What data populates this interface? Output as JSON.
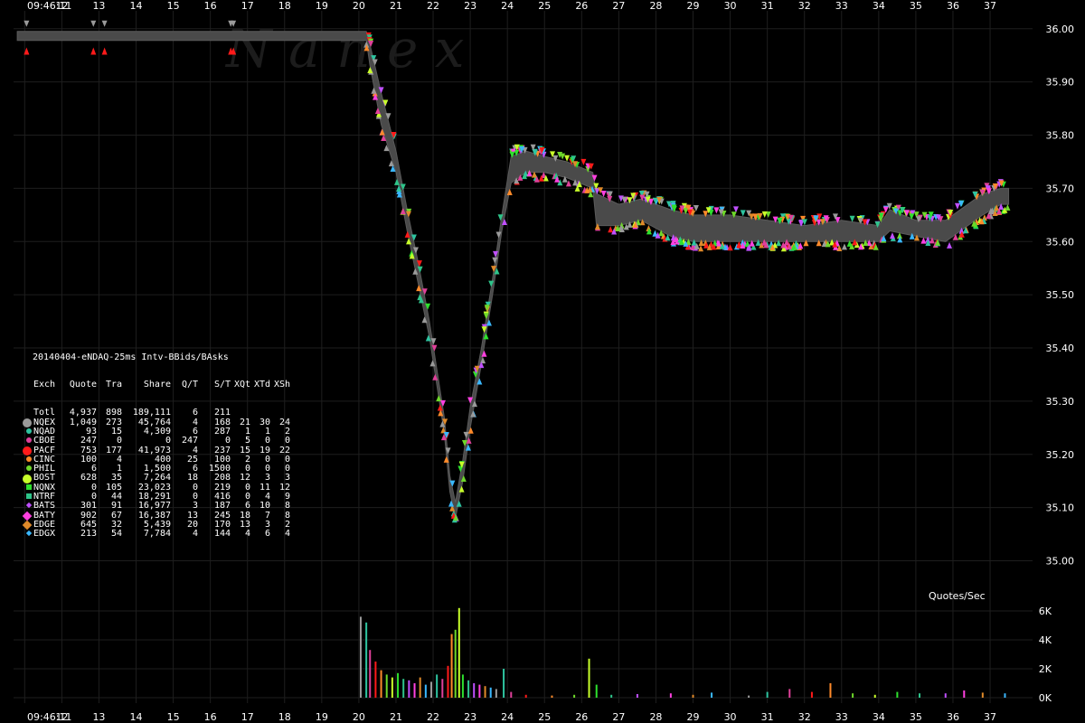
{
  "watermark": "N a n e x",
  "chart_data": [
    {
      "type": "scatter",
      "title": "",
      "xlabel": "",
      "ylabel": "",
      "x_ticks": [
        "09:46:11",
        "12",
        "13",
        "14",
        "15",
        "16",
        "17",
        "18",
        "19",
        "20",
        "21",
        "22",
        "23",
        "24",
        "25",
        "26",
        "27",
        "28",
        "29",
        "30",
        "31",
        "32",
        "33",
        "34",
        "35",
        "36",
        "37"
      ],
      "x_tick_values": [
        11,
        12,
        13,
        14,
        15,
        16,
        17,
        18,
        19,
        20,
        21,
        22,
        23,
        24,
        25,
        26,
        27,
        28,
        29,
        30,
        31,
        32,
        33,
        34,
        35,
        36,
        37
      ],
      "x_range": [
        10.7,
        37.9
      ],
      "y_ticks": [
        "36.00",
        "35.90",
        "35.80",
        "35.70",
        "35.60",
        "35.50",
        "35.40",
        "35.30",
        "35.20",
        "35.10",
        "35.00"
      ],
      "y_range": [
        34.95,
        36.02
      ],
      "nbbo_band": [
        [
          10.8,
          35.978,
          35.995
        ],
        [
          20.2,
          35.978,
          35.995
        ],
        [
          20.3,
          35.93,
          35.97
        ],
        [
          20.6,
          35.82,
          35.88
        ],
        [
          21.0,
          35.73,
          35.77
        ],
        [
          21.3,
          35.62,
          35.66
        ],
        [
          21.6,
          35.52,
          35.56
        ],
        [
          21.9,
          35.42,
          35.45
        ],
        [
          22.1,
          35.33,
          35.36
        ],
        [
          22.3,
          35.24,
          35.27
        ],
        [
          22.45,
          35.13,
          35.16
        ],
        [
          22.6,
          35.08,
          35.11
        ],
        [
          22.8,
          35.15,
          35.19
        ],
        [
          23.0,
          35.25,
          35.29
        ],
        [
          23.3,
          35.37,
          35.4
        ],
        [
          23.6,
          35.5,
          35.53
        ],
        [
          23.85,
          35.62,
          35.65
        ],
        [
          24.1,
          35.71,
          35.76
        ],
        [
          24.5,
          35.73,
          35.77
        ],
        [
          25.0,
          35.73,
          35.76
        ],
        [
          25.6,
          35.72,
          35.75
        ],
        [
          26.3,
          35.7,
          35.73
        ],
        [
          26.4,
          35.63,
          35.69
        ],
        [
          27.0,
          35.63,
          35.67
        ],
        [
          27.6,
          35.64,
          35.68
        ],
        [
          28.4,
          35.61,
          35.66
        ],
        [
          29.0,
          35.6,
          35.65
        ],
        [
          30.0,
          35.6,
          35.65
        ],
        [
          31.0,
          35.6,
          35.64
        ],
        [
          32.0,
          35.6,
          35.63
        ],
        [
          33.0,
          35.6,
          35.64
        ],
        [
          34.0,
          35.6,
          35.63
        ],
        [
          34.3,
          35.62,
          35.66
        ],
        [
          35.0,
          35.61,
          35.64
        ],
        [
          35.8,
          35.6,
          35.64
        ],
        [
          36.2,
          35.62,
          35.66
        ],
        [
          36.8,
          35.65,
          35.69
        ],
        [
          37.3,
          35.67,
          35.7
        ],
        [
          37.5,
          35.67,
          35.7
        ]
      ],
      "early_quotes": [
        {
          "x": 11.05,
          "bid": 35.975,
          "ask": 35.995
        },
        {
          "x": 12.85,
          "bid": 35.975,
          "ask": 35.995
        },
        {
          "x": 13.15,
          "bid": 35.975,
          "ask": 35.995
        },
        {
          "x": 16.55,
          "bid": 35.975,
          "ask": 35.995
        },
        {
          "x": 16.62,
          "bid": 35.975,
          "ask": 35.995
        }
      ],
      "colors": {
        "background": "#000000",
        "band": "#4a4a4a",
        "grid": "#1e1e1e",
        "axis_text": "#ffffff"
      }
    },
    {
      "type": "bar",
      "title": "Quotes/Sec",
      "y_ticks": [
        "6K",
        "4K",
        "2K",
        "0K"
      ],
      "y_range": [
        0,
        6500
      ],
      "bars": [
        {
          "x": 20.05,
          "v": 5600
        },
        {
          "x": 20.2,
          "v": 5200
        },
        {
          "x": 20.3,
          "v": 3300
        },
        {
          "x": 20.45,
          "v": 2500
        },
        {
          "x": 20.6,
          "v": 1900
        },
        {
          "x": 20.75,
          "v": 1600
        },
        {
          "x": 20.9,
          "v": 1400
        },
        {
          "x": 21.05,
          "v": 1700
        },
        {
          "x": 21.2,
          "v": 1300
        },
        {
          "x": 21.35,
          "v": 1200
        },
        {
          "x": 21.5,
          "v": 1000
        },
        {
          "x": 21.65,
          "v": 1400
        },
        {
          "x": 21.8,
          "v": 900
        },
        {
          "x": 21.95,
          "v": 1100
        },
        {
          "x": 22.1,
          "v": 1600
        },
        {
          "x": 22.25,
          "v": 1300
        },
        {
          "x": 22.4,
          "v": 2200
        },
        {
          "x": 22.5,
          "v": 4400
        },
        {
          "x": 22.6,
          "v": 4700
        },
        {
          "x": 22.7,
          "v": 6200
        },
        {
          "x": 22.8,
          "v": 1600
        },
        {
          "x": 22.95,
          "v": 1200
        },
        {
          "x": 23.1,
          "v": 1000
        },
        {
          "x": 23.25,
          "v": 900
        },
        {
          "x": 23.4,
          "v": 800
        },
        {
          "x": 23.55,
          "v": 700
        },
        {
          "x": 23.7,
          "v": 600
        },
        {
          "x": 23.9,
          "v": 2000
        },
        {
          "x": 24.1,
          "v": 400
        },
        {
          "x": 24.5,
          "v": 200
        },
        {
          "x": 25.2,
          "v": 150
        },
        {
          "x": 25.8,
          "v": 200
        },
        {
          "x": 26.2,
          "v": 2700
        },
        {
          "x": 26.4,
          "v": 900
        },
        {
          "x": 26.8,
          "v": 200
        },
        {
          "x": 27.5,
          "v": 250
        },
        {
          "x": 28.4,
          "v": 300
        },
        {
          "x": 29.0,
          "v": 200
        },
        {
          "x": 29.5,
          "v": 350
        },
        {
          "x": 30.5,
          "v": 150
        },
        {
          "x": 31.0,
          "v": 400
        },
        {
          "x": 31.6,
          "v": 600
        },
        {
          "x": 32.2,
          "v": 400
        },
        {
          "x": 32.7,
          "v": 1000
        },
        {
          "x": 33.3,
          "v": 300
        },
        {
          "x": 33.9,
          "v": 200
        },
        {
          "x": 34.5,
          "v": 400
        },
        {
          "x": 35.1,
          "v": 300
        },
        {
          "x": 35.8,
          "v": 300
        },
        {
          "x": 36.3,
          "v": 500
        },
        {
          "x": 36.8,
          "v": 350
        },
        {
          "x": 37.4,
          "v": 300
        }
      ]
    }
  ],
  "table": {
    "title": "20140404-eNDAQ-25ms Intv-BBids/BAsks",
    "header": [
      "Exch",
      "Quote",
      "Tra",
      "Share",
      "Q/T",
      "S/T",
      "XQt",
      "XTd",
      "XSh"
    ],
    "rows": [
      {
        "ex": "Totl",
        "q": "4,937",
        "t": "898",
        "s": "189,111",
        "qt": "6",
        "st": "211",
        "x1": "",
        "x2": "",
        "x3": "",
        "color": "",
        "shape": ""
      },
      {
        "ex": "NQEX",
        "q": "1,049",
        "t": "273",
        "s": "45,764",
        "qt": "4",
        "st": "168",
        "x1": "21",
        "x2": "30",
        "x3": "24",
        "color": "#9a9a9a",
        "shape": "circle-lg"
      },
      {
        "ex": "NQAD",
        "q": "93",
        "t": "15",
        "s": "4,309",
        "qt": "6",
        "st": "287",
        "x1": "1",
        "x2": "1",
        "x3": "2",
        "color": "#2ec4a0",
        "shape": "circle"
      },
      {
        "ex": "CBOE",
        "q": "247",
        "t": "0",
        "s": "0",
        "qt": "247",
        "st": "0",
        "x1": "5",
        "x2": "0",
        "x3": "0",
        "color": "#e0409a",
        "shape": "circle"
      },
      {
        "ex": "PACF",
        "q": "753",
        "t": "177",
        "s": "41,973",
        "qt": "4",
        "st": "237",
        "x1": "15",
        "x2": "19",
        "x3": "22",
        "color": "#ff1a1a",
        "shape": "circle-lg"
      },
      {
        "ex": "CINC",
        "q": "100",
        "t": "4",
        "s": "400",
        "qt": "25",
        "st": "100",
        "x1": "2",
        "x2": "0",
        "x3": "0",
        "color": "#ff8a2a",
        "shape": "circle"
      },
      {
        "ex": "PHIL",
        "q": "6",
        "t": "1",
        "s": "1,500",
        "qt": "6",
        "st": "1500",
        "x1": "0",
        "x2": "0",
        "x3": "0",
        "color": "#6ed82a",
        "shape": "circle"
      },
      {
        "ex": "BOST",
        "q": "628",
        "t": "35",
        "s": "7,264",
        "qt": "18",
        "st": "208",
        "x1": "12",
        "x2": "3",
        "x3": "3",
        "color": "#c8ff2a",
        "shape": "circle-lg"
      },
      {
        "ex": "NQNX",
        "q": "0",
        "t": "105",
        "s": "23,023",
        "qt": "0",
        "st": "219",
        "x1": "0",
        "x2": "11",
        "x3": "12",
        "color": "#2ee02e",
        "shape": "square"
      },
      {
        "ex": "NTRF",
        "q": "0",
        "t": "44",
        "s": "18,291",
        "qt": "0",
        "st": "416",
        "x1": "0",
        "x2": "4",
        "x3": "9",
        "color": "#2ec48a",
        "shape": "square"
      },
      {
        "ex": "BATS",
        "q": "301",
        "t": "91",
        "s": "16,977",
        "qt": "3",
        "st": "187",
        "x1": "6",
        "x2": "10",
        "x3": "8",
        "color": "#c050ff",
        "shape": "diamond"
      },
      {
        "ex": "BATY",
        "q": "902",
        "t": "67",
        "s": "16,387",
        "qt": "13",
        "st": "245",
        "x1": "18",
        "x2": "7",
        "x3": "8",
        "color": "#ff40e0",
        "shape": "diamond-lg"
      },
      {
        "ex": "EDGE",
        "q": "645",
        "t": "32",
        "s": "5,439",
        "qt": "20",
        "st": "170",
        "x1": "13",
        "x2": "3",
        "x3": "2",
        "color": "#e08a2a",
        "shape": "diamond-lg"
      },
      {
        "ex": "EDGX",
        "q": "213",
        "t": "54",
        "s": "7,784",
        "qt": "4",
        "st": "144",
        "x1": "4",
        "x2": "6",
        "x3": "4",
        "color": "#3ab8ff",
        "shape": "diamond"
      }
    ]
  }
}
